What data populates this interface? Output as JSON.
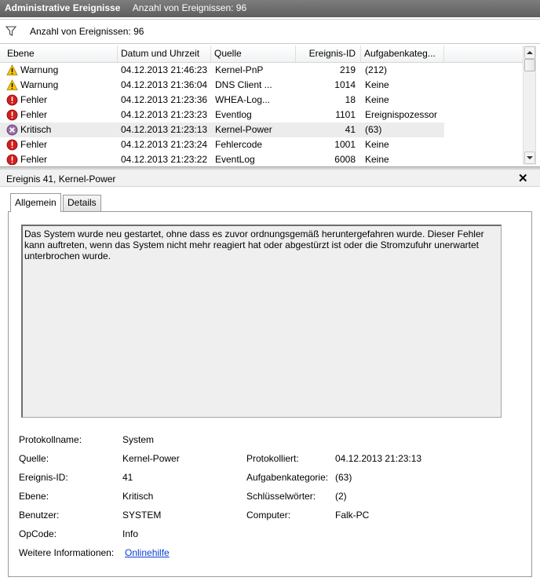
{
  "title": {
    "main": "Administrative Ereignisse",
    "count_text": "Anzahl von Ereignissen: 96"
  },
  "filter": {
    "icon": "filter-icon",
    "text": "Anzahl von Ereignissen: 96"
  },
  "columns": [
    "Ebene",
    "Datum und Uhrzeit",
    "Quelle",
    "Ereignis-ID",
    "Aufgabenkateg..."
  ],
  "events": [
    {
      "level": "Warnung",
      "icon": "warning-icon",
      "datetime": "04.12.2013 21:46:23",
      "source": "Kernel-PnP",
      "id": "219",
      "category": "(212)",
      "selected": false
    },
    {
      "level": "Warnung",
      "icon": "warning-icon",
      "datetime": "04.12.2013 21:36:04",
      "source": "DNS Client ...",
      "id": "1014",
      "category": "Keine",
      "selected": false
    },
    {
      "level": "Fehler",
      "icon": "error-icon",
      "datetime": "04.12.2013 21:23:36",
      "source": "WHEA-Log...",
      "id": "18",
      "category": "Keine",
      "selected": false
    },
    {
      "level": "Fehler",
      "icon": "error-icon",
      "datetime": "04.12.2013 21:23:23",
      "source": "Eventlog",
      "id": "1101",
      "category": "Ereignispozessor",
      "selected": false
    },
    {
      "level": "Kritisch",
      "icon": "critical-icon",
      "datetime": "04.12.2013 21:23:13",
      "source": "Kernel-Power",
      "id": "41",
      "category": "(63)",
      "selected": true
    },
    {
      "level": "Fehler",
      "icon": "error-icon",
      "datetime": "04.12.2013 21:23:24",
      "source": "Fehlercode",
      "id": "1001",
      "category": "Keine",
      "selected": false
    },
    {
      "level": "Fehler",
      "icon": "error-icon",
      "datetime": "04.12.2013 21:23:22",
      "source": "EventLog",
      "id": "6008",
      "category": "Keine",
      "selected": false
    }
  ],
  "detail": {
    "title": "Ereignis 41, Kernel-Power",
    "close": "✕",
    "tabs": {
      "general": "Allgemein",
      "details": "Details"
    },
    "description": "Das System wurde neu gestartet, ohne dass es zuvor ordnungsgemäß heruntergefahren wurde. Dieser Fehler kann auftreten, wenn das System nicht mehr reagiert hat oder abgestürzt ist oder die Stromzufuhr unerwartet unterbrochen wurde.",
    "props": {
      "logname_label": "Protokollname:",
      "logname": "System",
      "source_label": "Quelle:",
      "source": "Kernel-Power",
      "logged_label": "Protokolliert:",
      "logged": "04.12.2013 21:23:13",
      "eventid_label": "Ereignis-ID:",
      "eventid": "41",
      "taskcat_label": "Aufgabenkategorie:",
      "taskcat": "(63)",
      "level_label": "Ebene:",
      "level": "Kritisch",
      "keywords_label": "Schlüsselwörter:",
      "keywords": "(2)",
      "user_label": "Benutzer:",
      "user": "SYSTEM",
      "computer_label": "Computer:",
      "computer": "Falk-PC",
      "opcode_label": "OpCode:",
      "opcode": "Info",
      "moreinfo_label": "Weitere Informationen:",
      "moreinfo_link": "Onlinehilfe"
    }
  }
}
